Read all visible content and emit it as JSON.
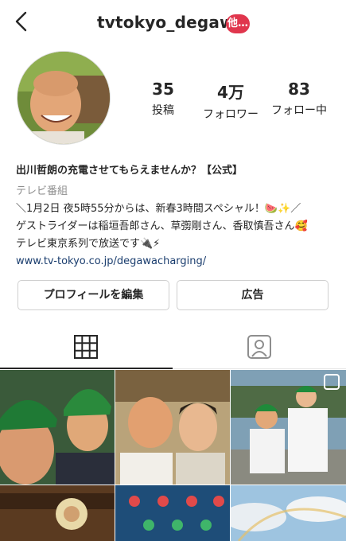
{
  "header": {
    "username": "tvtokyo_degawa",
    "badge": "他…",
    "back_icon": "chevron-left-icon"
  },
  "stats": [
    {
      "value": "35",
      "label": "投稿"
    },
    {
      "value": "4万",
      "label": "フォロワー"
    },
    {
      "value": "83",
      "label": "フォロー中"
    }
  ],
  "bio": {
    "name": "出川哲朗の充電させてもらえませんか？【公式】",
    "category": "テレビ番組",
    "lines": [
      "＼1月2日 夜5時55分からは、新春3時間スペシャル！🍉✨／",
      "ゲストライダーは稲垣吾郎さん、草彅剛さん、香取慎吾さん🥰",
      "テレビ東京系列で放送です🔌⚡"
    ],
    "link": "www.tv-tokyo.co.jp/degawacharging/"
  },
  "buttons": {
    "edit_profile": "プロフィールを編集",
    "ads": "広告"
  },
  "tabs": [
    {
      "icon": "grid-icon",
      "active": true
    },
    {
      "icon": "tagged-person-icon",
      "active": false
    }
  ],
  "colors": {
    "badge": "#e0364d",
    "link": "#1a3d6e",
    "muted": "#8e8e8e"
  }
}
